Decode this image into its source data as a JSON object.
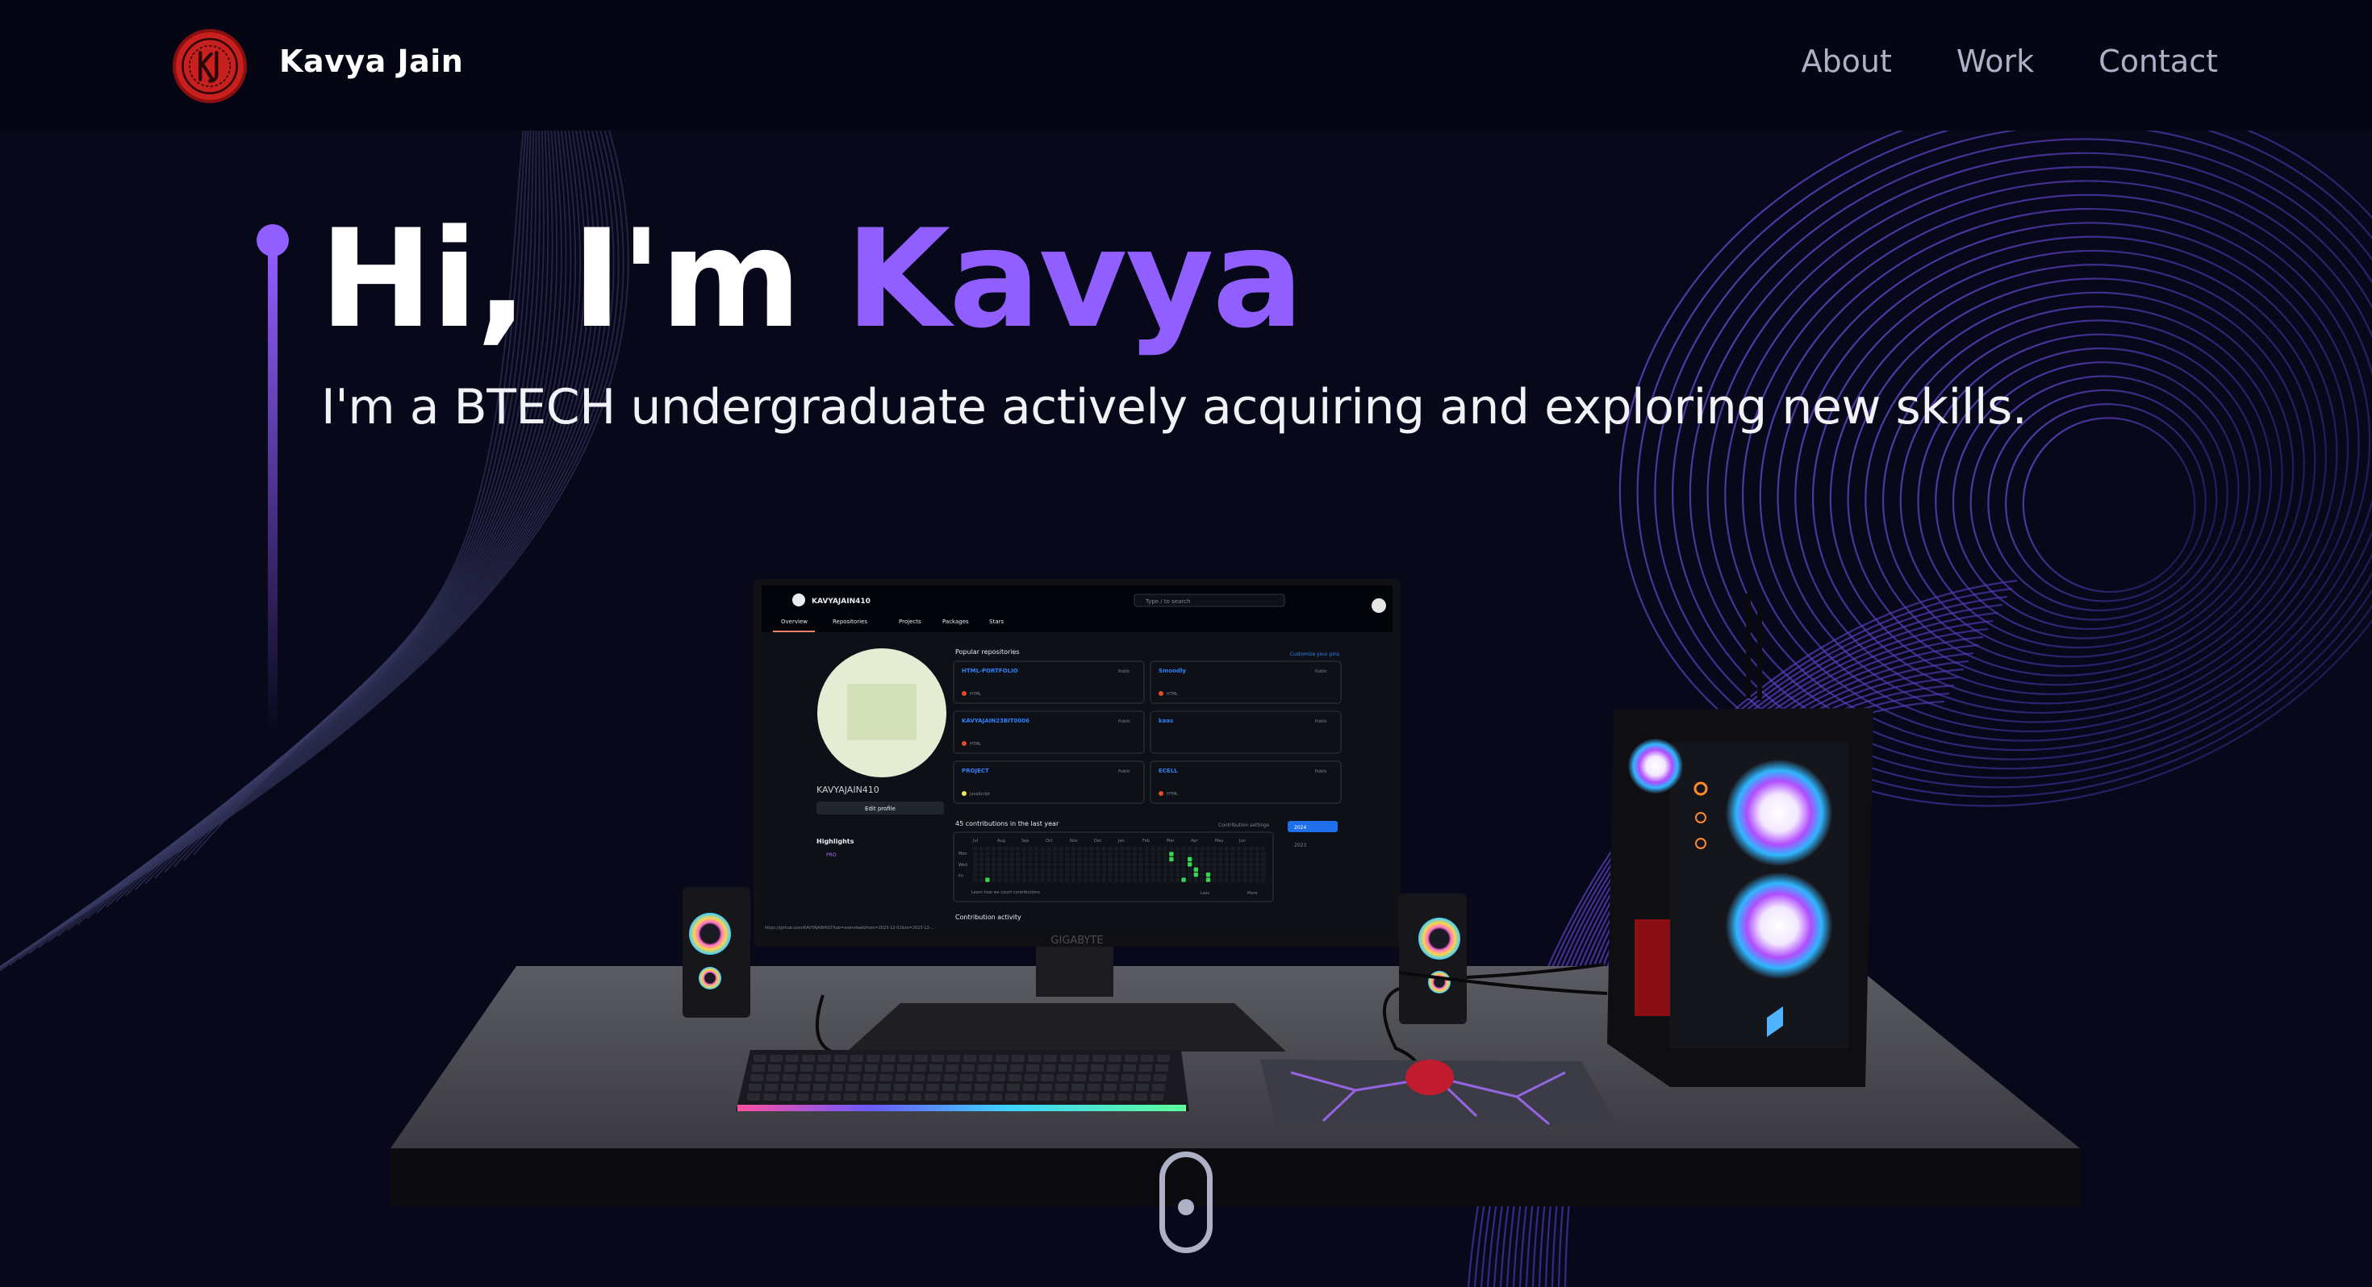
{
  "nav": {
    "brand": "Kavya Jain",
    "links": [
      "About",
      "Work",
      "Contact"
    ]
  },
  "hero": {
    "greeting": "Hi, I'm",
    "name": "Kavya",
    "subtitle": "I'm a BTECH undergraduate actively acquiring and exploring new skills."
  },
  "monitor_screen": {
    "username": "KAVYAJAIN410",
    "tabs": [
      "Overview",
      "Repositories",
      "Projects",
      "Packages",
      "Stars"
    ],
    "search_placeholder": "Type / to search",
    "popular_repositories_label": "Popular repositories",
    "customize_label": "Customize your pins",
    "repos": [
      {
        "name": "HTML-PORTFOLIO",
        "badge": "Public",
        "lang": "HTML"
      },
      {
        "name": "Smoodly",
        "badge": "Public",
        "lang": "HTML"
      },
      {
        "name": "KAVYAJAIN23BIT0006",
        "badge": "Public",
        "lang": "HTML"
      },
      {
        "name": "kaas",
        "badge": "Public",
        "lang": ""
      },
      {
        "name": "PROJECT",
        "badge": "Public",
        "lang": "JavaScript"
      },
      {
        "name": "ECELL",
        "badge": "Public",
        "lang": "HTML"
      }
    ],
    "profile_name": "KAVYAJAIN410",
    "edit_profile": "Edit profile",
    "highlights_label": "Highlights",
    "pro_badge": "PRO",
    "contributions_label": "45 contributions in the last year",
    "contribution_settings": "Contribution settings",
    "years": [
      "2024",
      "2023"
    ],
    "months": [
      "Jul",
      "Aug",
      "Sep",
      "Oct",
      "Nov",
      "Dec",
      "Jan",
      "Feb",
      "Mar",
      "Apr",
      "May",
      "Jun"
    ],
    "days": [
      "Mon",
      "Wed",
      "Fri"
    ],
    "learn_text": "Learn how we count contributions",
    "less_label": "Less",
    "more_label": "More",
    "activity_label": "Contribution activity",
    "url_text": "https://github.com/KAVYAJAIN410?tab=overview&from=2023-12-01&to=2023-12-...",
    "monitor_brand": "GIGABYTE"
  },
  "colors": {
    "background": "#070819",
    "accent": "#915eff",
    "nav_link": "#aeb0c6",
    "logo_red": "#c8201e"
  },
  "icons": [
    "logo-monogram-icon",
    "scroll-mouse-icon",
    "github-icon",
    "search-icon"
  ]
}
